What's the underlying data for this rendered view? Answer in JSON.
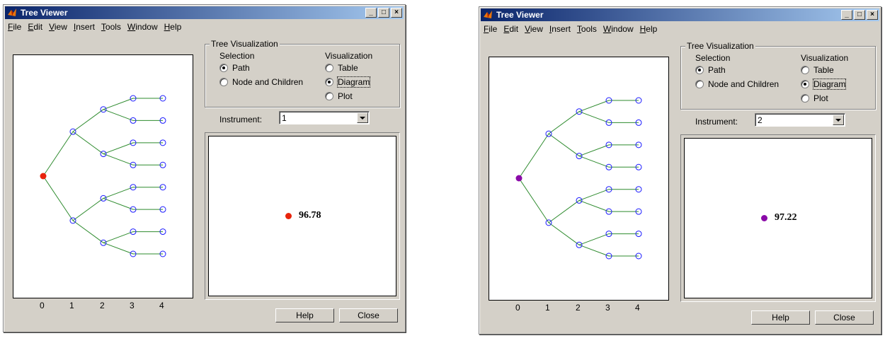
{
  "windows": [
    {
      "title": "Tree Viewer",
      "menu": [
        "File",
        "Edit",
        "View",
        "Insert",
        "Tools",
        "Window",
        "Help"
      ],
      "menu_mnemonics": [
        "F",
        "E",
        "V",
        "I",
        "T",
        "W",
        "H"
      ],
      "group_title": "Tree Visualization",
      "selection_label": "Selection",
      "visualization_label": "Visualization",
      "selection_options": [
        "Path",
        "Node and Children"
      ],
      "selection_selected": "Path",
      "visualization_options": [
        "Table",
        "Diagram",
        "Plot"
      ],
      "visualization_selected": "Diagram",
      "instrument_label": "Instrument:",
      "instrument_value": "1",
      "axis_ticks": [
        "0",
        "1",
        "2",
        "3",
        "4"
      ],
      "value": "96.78",
      "value_color": "#e8240c",
      "help_label": "Help",
      "close_label": "Close"
    },
    {
      "title": "Tree Viewer",
      "menu": [
        "File",
        "Edit",
        "View",
        "Insert",
        "Tools",
        "Window",
        "Help"
      ],
      "menu_mnemonics": [
        "F",
        "E",
        "V",
        "I",
        "T",
        "W",
        "H"
      ],
      "group_title": "Tree Visualization",
      "selection_label": "Selection",
      "visualization_label": "Visualization",
      "selection_options": [
        "Path",
        "Node and Children"
      ],
      "selection_selected": "Path",
      "visualization_options": [
        "Table",
        "Diagram",
        "Plot"
      ],
      "visualization_selected": "Diagram",
      "instrument_label": "Instrument:",
      "instrument_value": "2",
      "axis_ticks": [
        "0",
        "1",
        "2",
        "3",
        "4"
      ],
      "value": "97.22",
      "value_color": "#8a0aa8",
      "help_label": "Help",
      "close_label": "Close"
    }
  ],
  "colors": {
    "node_open": "#1a1aff",
    "edge": "#2e8b2e"
  }
}
